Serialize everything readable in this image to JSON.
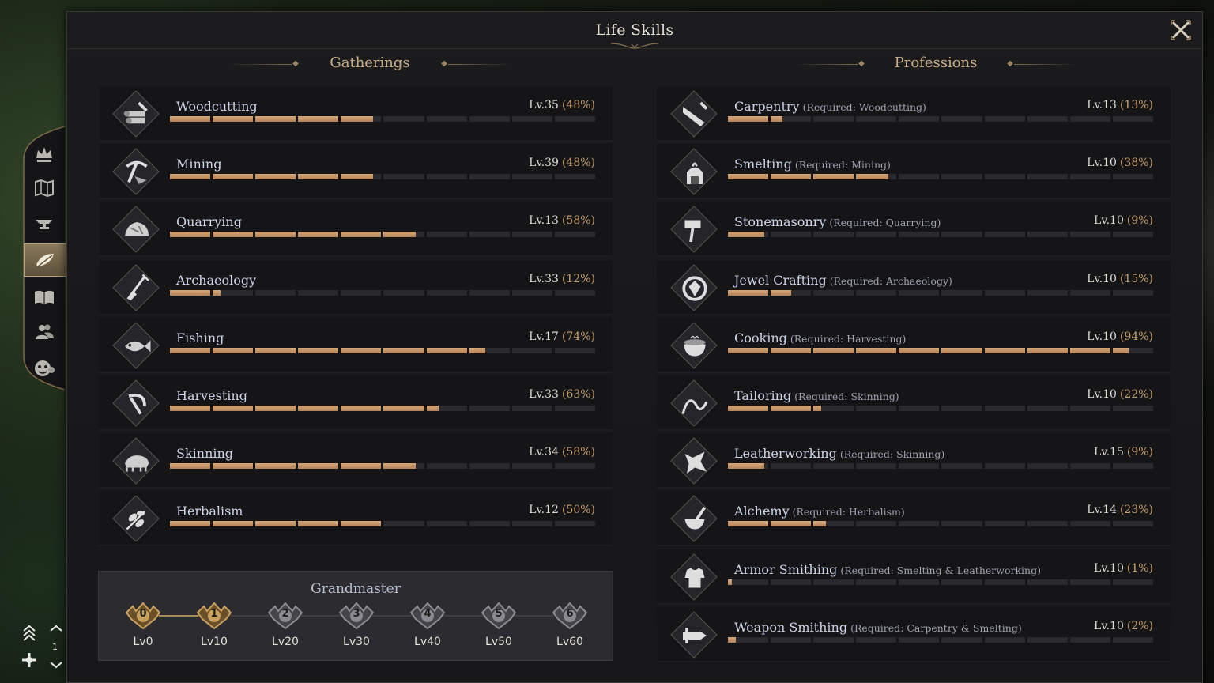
{
  "window": {
    "title": "Life Skills"
  },
  "sections": {
    "gatherings": "Gatherings",
    "professions": "Professions"
  },
  "gatherings": [
    {
      "name": "Woodcutting",
      "level": "Lv.35",
      "percent": "(48%)",
      "progress": 0.48,
      "icon": "logs-icon"
    },
    {
      "name": "Mining",
      "level": "Lv.39",
      "percent": "(48%)",
      "progress": 0.48,
      "icon": "pickaxe-icon"
    },
    {
      "name": "Quarrying",
      "level": "Lv.13",
      "percent": "(58%)",
      "progress": 0.58,
      "icon": "stone-icon"
    },
    {
      "name": "Archaeology",
      "level": "Lv.33",
      "percent": "(12%)",
      "progress": 0.12,
      "icon": "shovel-icon"
    },
    {
      "name": "Fishing",
      "level": "Lv.17",
      "percent": "(74%)",
      "progress": 0.74,
      "icon": "fish-icon"
    },
    {
      "name": "Harvesting",
      "level": "Lv.33",
      "percent": "(63%)",
      "progress": 0.63,
      "icon": "sickle-icon"
    },
    {
      "name": "Skinning",
      "level": "Lv.34",
      "percent": "(58%)",
      "progress": 0.58,
      "icon": "boar-icon"
    },
    {
      "name": "Herbalism",
      "level": "Lv.12",
      "percent": "(50%)",
      "progress": 0.5,
      "icon": "herb-icon"
    }
  ],
  "professions": [
    {
      "name": "Carpentry",
      "req": "(Required: Woodcutting)",
      "level": "Lv.13",
      "percent": "(13%)",
      "progress": 0.13,
      "icon": "saw-icon"
    },
    {
      "name": "Smelting",
      "req": "(Required: Mining)",
      "level": "Lv.10",
      "percent": "(38%)",
      "progress": 0.38,
      "icon": "furnace-icon"
    },
    {
      "name": "Stonemasonry",
      "req": "(Required: Quarrying)",
      "level": "Lv.10",
      "percent": "(9%)",
      "progress": 0.09,
      "icon": "hammer-icon"
    },
    {
      "name": "Jewel Crafting",
      "req": "(Required: Archaeology)",
      "level": "Lv.10",
      "percent": "(15%)",
      "progress": 0.15,
      "icon": "gem-icon"
    },
    {
      "name": "Cooking",
      "req": "(Required: Harvesting)",
      "level": "Lv.10",
      "percent": "(94%)",
      "progress": 0.94,
      "icon": "pot-icon"
    },
    {
      "name": "Tailoring",
      "req": "(Required: Skinning)",
      "level": "Lv.10",
      "percent": "(22%)",
      "progress": 0.22,
      "icon": "needle-icon"
    },
    {
      "name": "Leatherworking",
      "req": "(Required: Skinning)",
      "level": "Lv.15",
      "percent": "(9%)",
      "progress": 0.09,
      "icon": "hide-icon"
    },
    {
      "name": "Alchemy",
      "req": "(Required: Herbalism)",
      "level": "Lv.14",
      "percent": "(23%)",
      "progress": 0.23,
      "icon": "mortar-icon"
    },
    {
      "name": "Armor Smithing",
      "req": "(Required: Smelting & Leatherworking)",
      "level": "Lv.10",
      "percent": "(1%)",
      "progress": 0.01,
      "icon": "armor-icon"
    },
    {
      "name": "Weapon Smithing",
      "req": "(Required: Carpentry & Smelting)",
      "level": "Lv.10",
      "percent": "(2%)",
      "progress": 0.02,
      "icon": "sword-icon"
    }
  ],
  "grandmaster": {
    "title": "Grandmaster",
    "tiers": [
      {
        "num": "0",
        "label": "Lv0",
        "reached": true
      },
      {
        "num": "1",
        "label": "Lv10",
        "reached": true
      },
      {
        "num": "2",
        "label": "Lv20",
        "reached": false
      },
      {
        "num": "3",
        "label": "Lv30",
        "reached": false
      },
      {
        "num": "4",
        "label": "Lv40",
        "reached": false
      },
      {
        "num": "5",
        "label": "Lv50",
        "reached": false
      },
      {
        "num": "6",
        "label": "Lv60",
        "reached": false
      }
    ]
  },
  "sidebar": [
    "crown-icon",
    "map-icon",
    "anvil-icon",
    "life-skills-icon",
    "book-icon",
    "people-icon",
    "mask-icon"
  ],
  "hud": {
    "count": "1"
  },
  "colors": {
    "accent": "#c8a26c",
    "bar_fill": "#c69565",
    "text_name": "#cfd5e8"
  }
}
